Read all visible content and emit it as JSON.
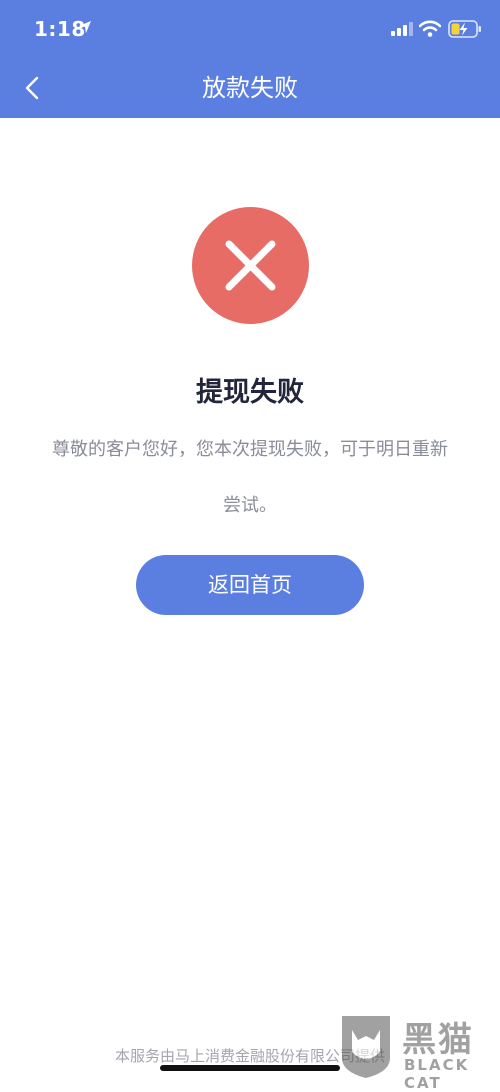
{
  "status_bar": {
    "time": "1:18",
    "icons": [
      "location-arrow-icon",
      "signal-icon",
      "wifi-icon",
      "battery-charging-icon"
    ]
  },
  "nav": {
    "back_icon": "chevron-left-icon",
    "title": "放款失败"
  },
  "result": {
    "icon": "close-icon",
    "title": "提现失败",
    "message": "尊敬的客户您好，您本次提现失败，可于明日重新尝试。"
  },
  "actions": {
    "home_button_label": "返回首页"
  },
  "footer": {
    "provider_text": "本服务由马上消费金融股份有限公司提供"
  },
  "watermark": {
    "brand": "黑猫",
    "sub": "BLACK CAT"
  },
  "colors": {
    "primary": "#5b7fe0",
    "error": "#e76c66",
    "title_text": "#22263a",
    "body_text": "#8a8d99"
  }
}
